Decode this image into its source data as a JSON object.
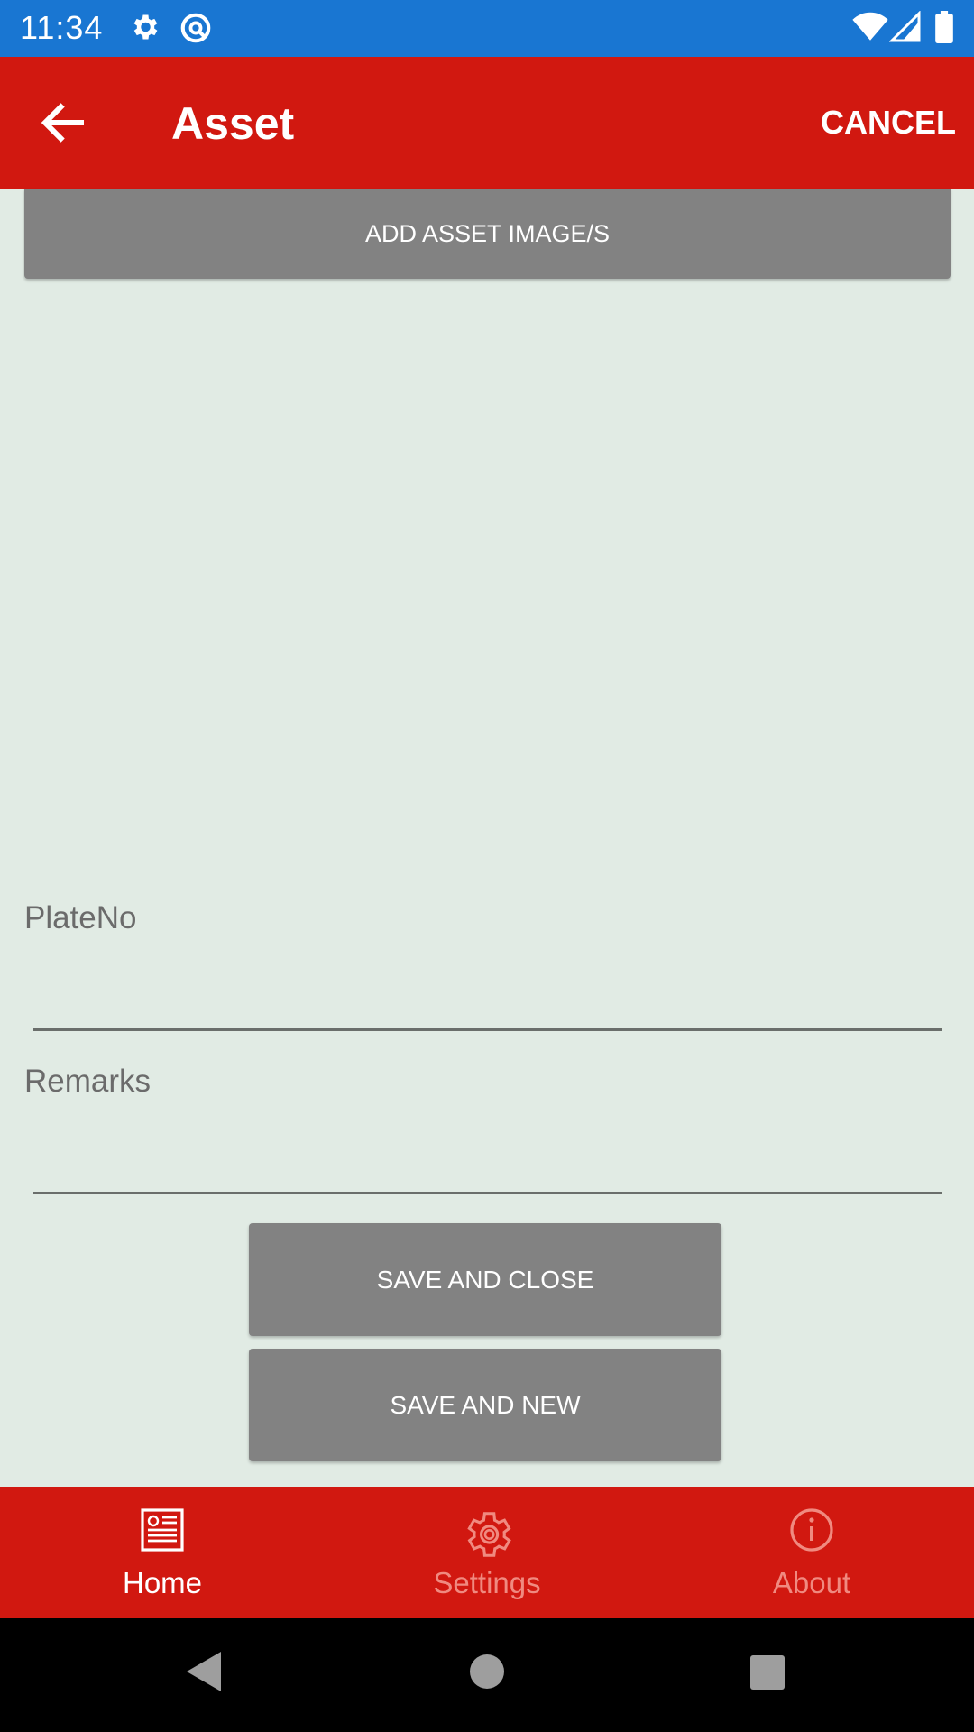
{
  "status_bar": {
    "time": "11:34",
    "icons": [
      "settings-gear-icon",
      "sync-icon",
      "wifi-icon",
      "signal-icon",
      "battery-icon"
    ]
  },
  "app_bar": {
    "back_icon": "arrow-left-icon",
    "title": "Asset",
    "cancel_label": "CANCEL"
  },
  "form": {
    "add_image_label": "ADD ASSET IMAGE/S",
    "plate_label": "PlateNo",
    "plate_value": "",
    "remarks_label": "Remarks",
    "remarks_value": "",
    "save_close_label": "SAVE AND CLOSE",
    "save_new_label": "SAVE AND NEW"
  },
  "tabs": [
    {
      "label": "Home",
      "icon": "news-icon",
      "active": true
    },
    {
      "label": "Settings",
      "icon": "gear-icon",
      "active": false
    },
    {
      "label": "About",
      "icon": "info-icon",
      "active": false
    }
  ],
  "colors": {
    "status_bar": "#1976d2",
    "app_bar": "#d11810",
    "background": "#e1ebe4",
    "button": "#828282",
    "tab_inactive": "#f08a80"
  }
}
